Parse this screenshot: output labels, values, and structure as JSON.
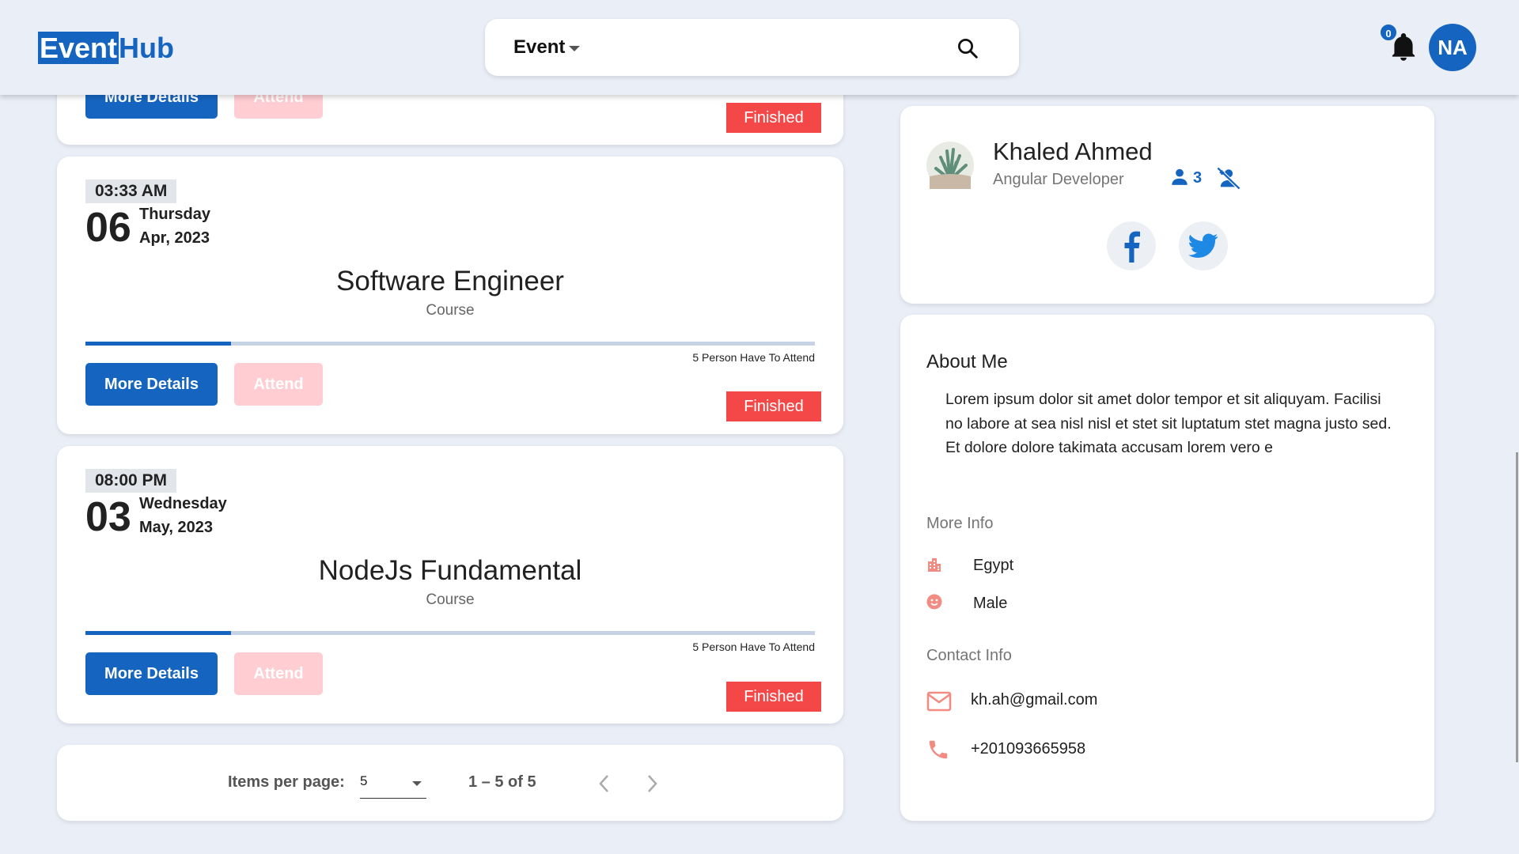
{
  "header": {
    "logo_part1": "Event",
    "logo_part2": "Hub",
    "search_category": "Event",
    "notification_count": "0",
    "user_initials": "NA"
  },
  "events": [
    {
      "more_label": "More Details",
      "attend_label": "Attend",
      "status": "Finished"
    },
    {
      "time": "03:33 AM",
      "day": "06",
      "weekday": "Thursday",
      "month_year": "Apr, 2023",
      "title": "Software Engineer",
      "type": "Course",
      "progress": 0.2,
      "attend_note": "5 Person Have To Attend",
      "more_label": "More Details",
      "attend_label": "Attend",
      "status": "Finished"
    },
    {
      "time": "08:00 PM",
      "day": "03",
      "weekday": "Wednesday",
      "month_year": "May, 2023",
      "title": "NodeJs Fundamental",
      "type": "Course",
      "progress": 0.2,
      "attend_note": "5 Person Have To Attend",
      "more_label": "More Details",
      "attend_label": "Attend",
      "status": "Finished"
    }
  ],
  "paginator": {
    "label": "Items per page:",
    "page_size": "5",
    "range": "1 – 5 of 5"
  },
  "profile": {
    "name": "Khaled Ahmed",
    "role": "Angular Developer",
    "followers": "3"
  },
  "about": {
    "title": "About Me",
    "text": "Lorem ipsum dolor sit amet dolor tempor et sit aliquyam. Facilisi no labore at sea nisl nisl et stet sit luptatum stet magna justo sed. Et dolore dolore takimata accusam lorem vero e",
    "more_info_title": "More Info",
    "country": "Egypt",
    "gender": "Male",
    "contact_title": "Contact Info",
    "email": "kh.ah@gmail.com",
    "phone": "+201093665958"
  },
  "colors": {
    "primary": "#1565c0",
    "finished": "#f44848",
    "attend_disabled": "#ffcdd2",
    "icon_salmon": "#f28b82",
    "background": "#eaeef7"
  }
}
